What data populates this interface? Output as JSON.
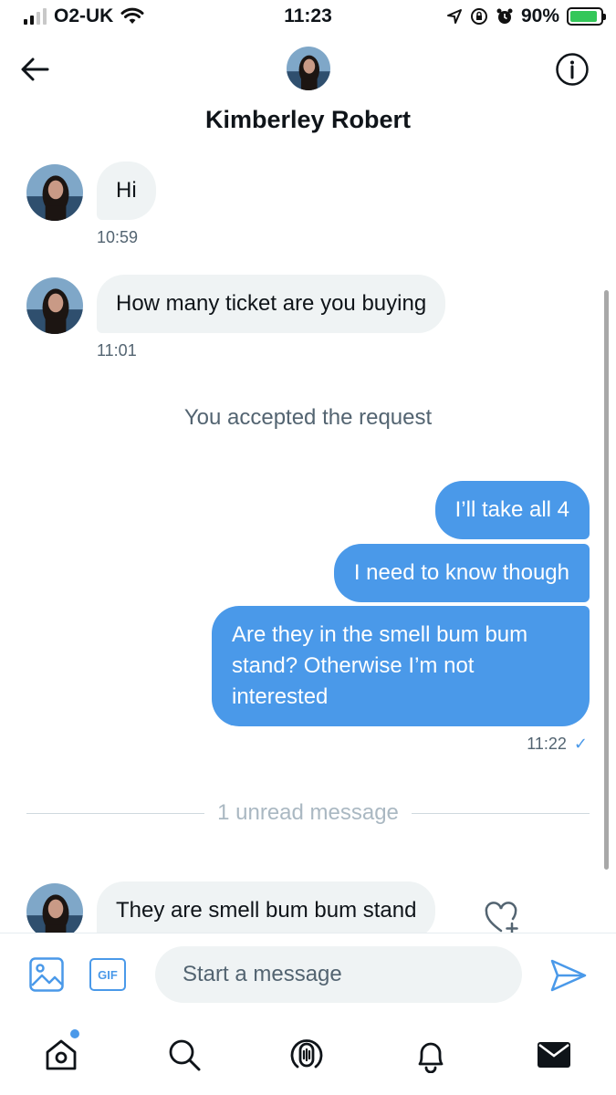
{
  "status_bar": {
    "carrier": "O2-UK",
    "time": "11:23",
    "battery_percent": "90%",
    "battery_level": 0.9
  },
  "header": {
    "contact_name": "Kimberley Robert",
    "back_icon": "arrow-left-icon",
    "info_icon": "info-icon"
  },
  "messages": {
    "incoming_1": {
      "text": "Hi",
      "time": "10:59"
    },
    "incoming_2": {
      "text": "How many ticket are you buying",
      "time": "11:01"
    },
    "system_note": "You accepted the request",
    "outgoing": [
      {
        "text": "I’ll take all 4"
      },
      {
        "text": "I need to know though"
      },
      {
        "text": "Are they in the smell bum bum stand? Otherwise I’m not interested"
      }
    ],
    "outgoing_time": "11:22",
    "read_mark": "✓",
    "unread_divider": "1 unread message",
    "incoming_3": {
      "text": "They are smell bum bum stand"
    }
  },
  "composer": {
    "placeholder": "Start a message",
    "gif_label": "GIF"
  },
  "tabs": [
    "home-icon",
    "search-icon",
    "spaces-icon",
    "notifications-icon",
    "messages-icon"
  ],
  "colors": {
    "accent": "#4a99e9",
    "incoming_bubble": "#eff3f4",
    "muted_text": "#536471"
  }
}
